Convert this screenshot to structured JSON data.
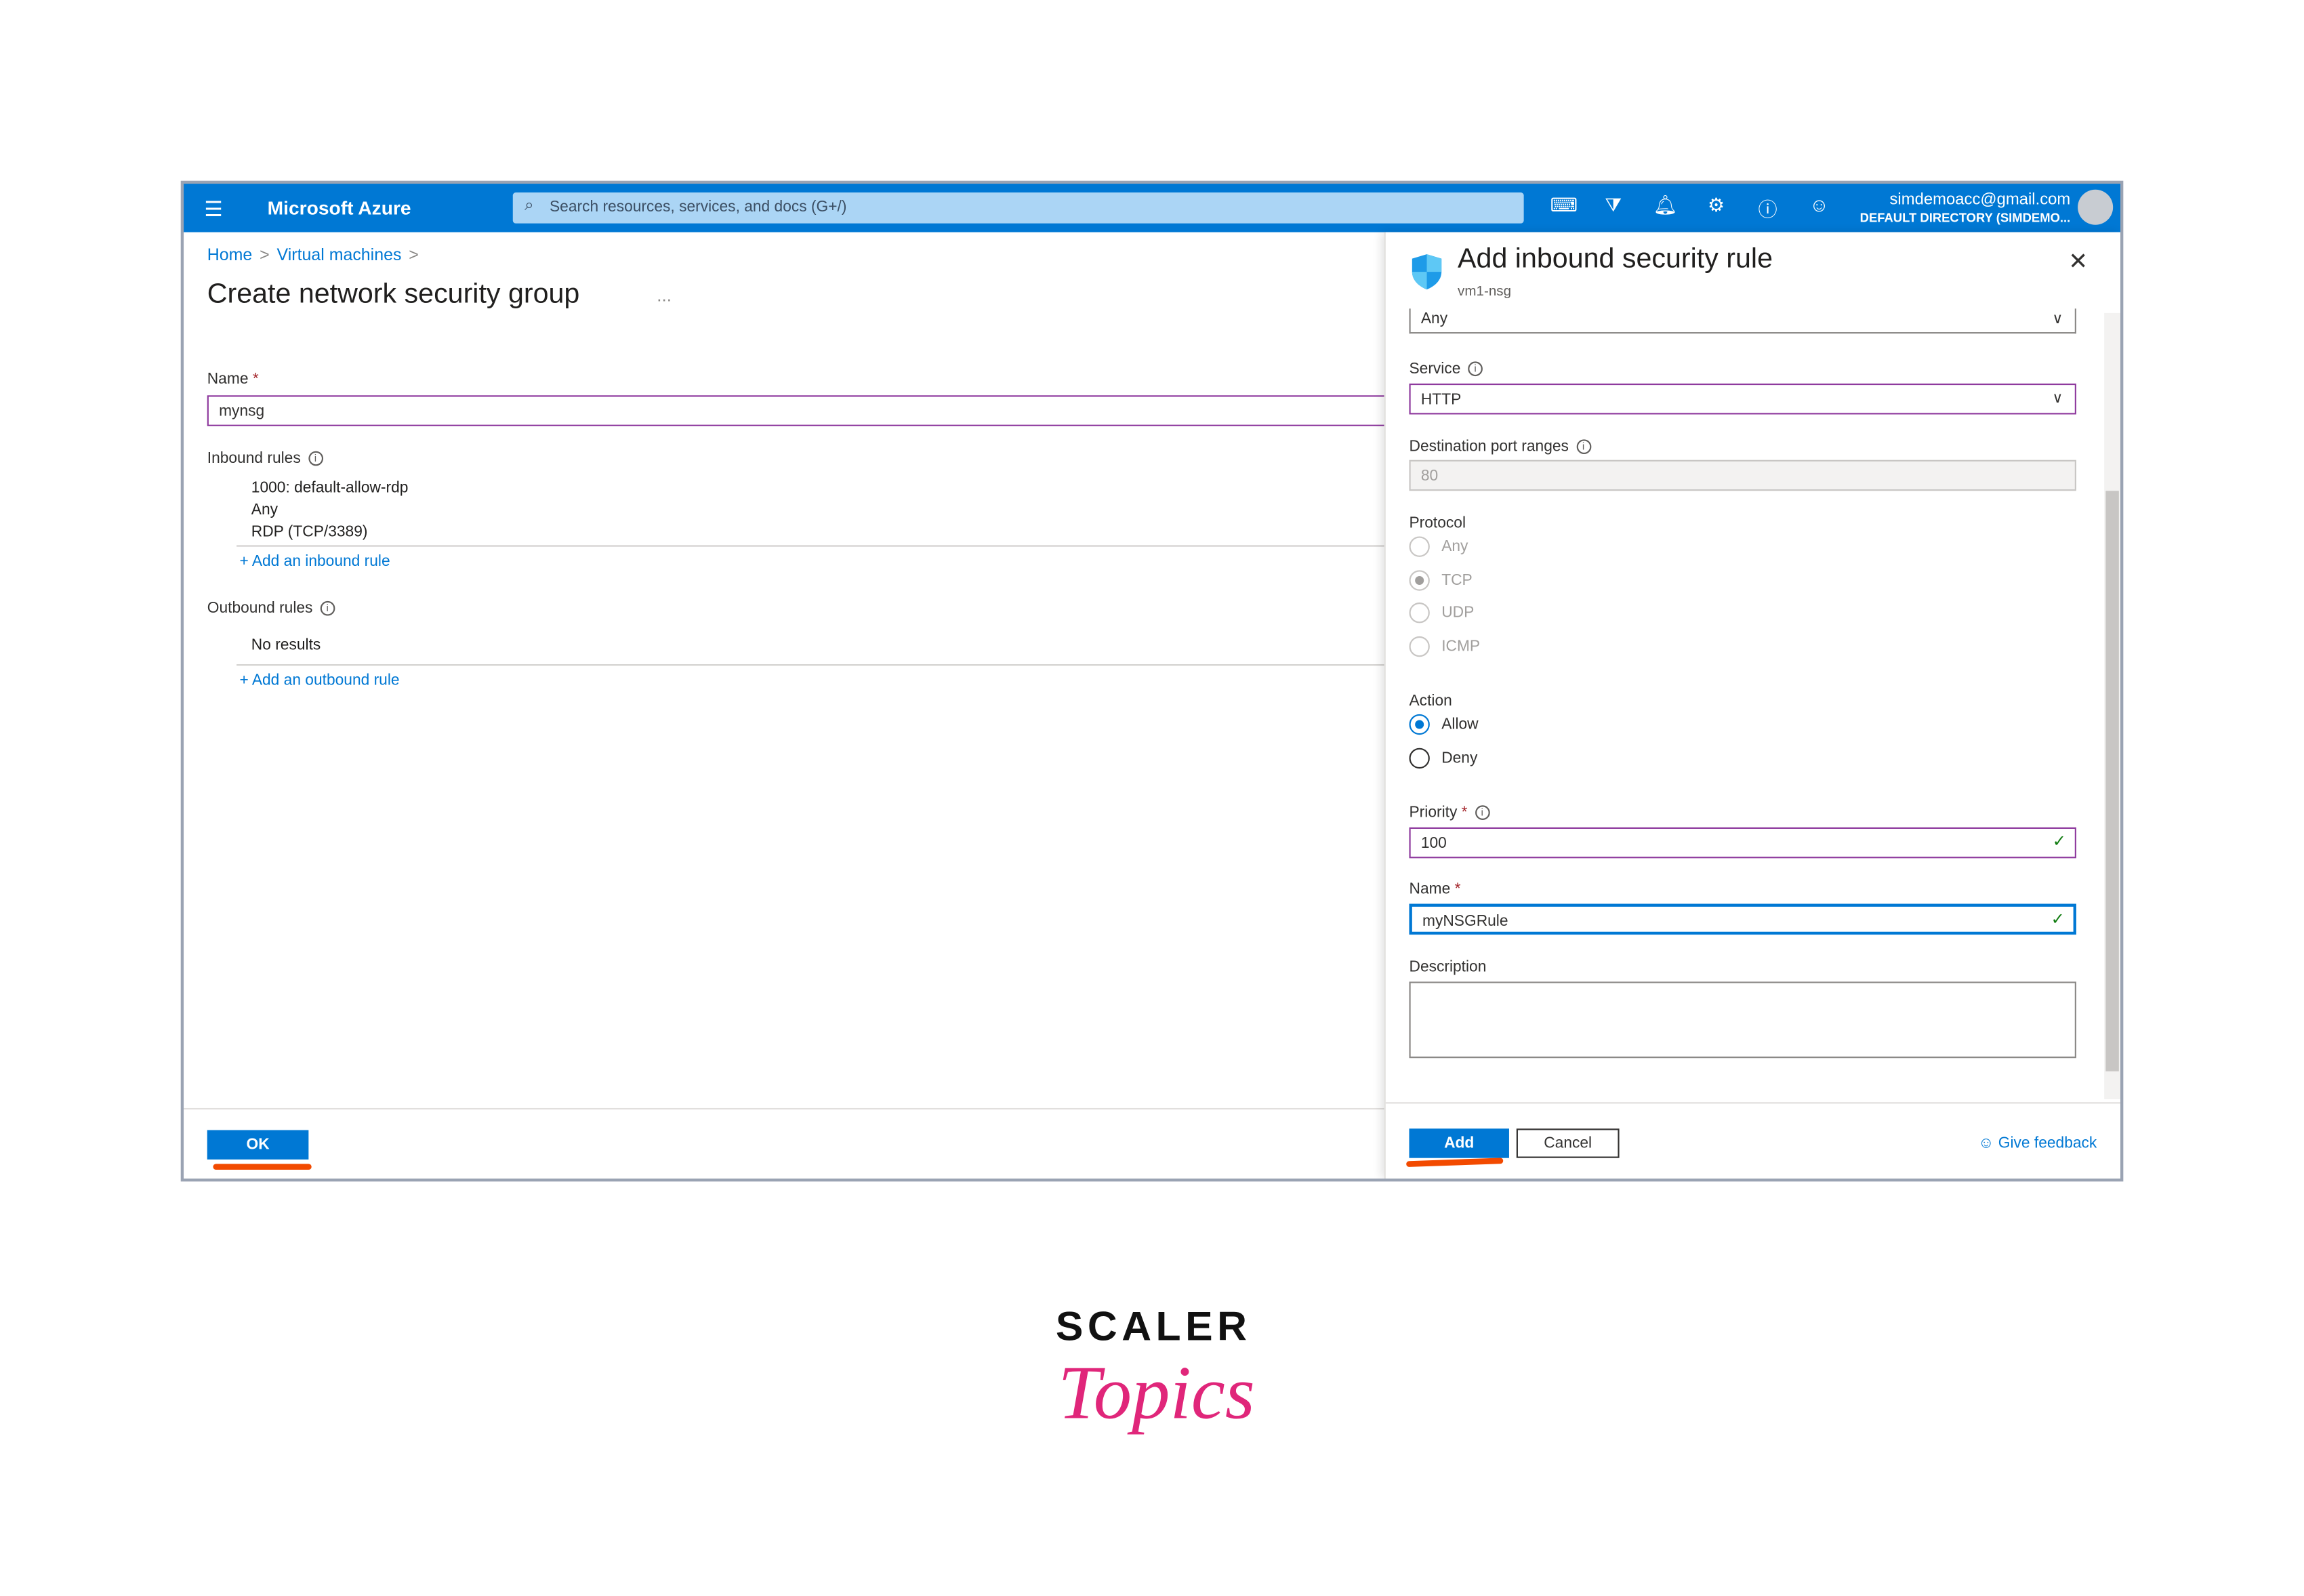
{
  "topbar": {
    "brand": "Microsoft Azure",
    "search_placeholder": "Search resources, services, and docs (G+/)",
    "account_email": "simdemoacc@gmail.com",
    "account_directory": "DEFAULT DIRECTORY (SIMDEMO...",
    "accent": "#0078d4"
  },
  "left": {
    "breadcrumb": [
      "Home",
      "Virtual machines"
    ],
    "title": "Create network security group",
    "more": "...",
    "name_label": "Name",
    "name_value": "mynsg",
    "inbound_label": "Inbound rules",
    "inbound_rule": [
      "1000: default-allow-rdp",
      "Any",
      "RDP (TCP/3389)"
    ],
    "add_inbound": "+ Add an inbound rule",
    "outbound_label": "Outbound rules",
    "outbound_empty": "No results",
    "add_outbound": "+ Add an outbound rule",
    "ok": "OK"
  },
  "panel": {
    "title": "Add inbound security rule",
    "subtitle": "vm1-nsg",
    "top_select": "Any",
    "service_label": "Service",
    "service_value": "HTTP",
    "port_label": "Destination port ranges",
    "port_value": "80",
    "protocol_label": "Protocol",
    "protocols": [
      "Any",
      "TCP",
      "UDP",
      "ICMP"
    ],
    "protocol_selected": "TCP",
    "action_label": "Action",
    "actions": [
      "Allow",
      "Deny"
    ],
    "action_selected": "Allow",
    "priority_label": "Priority",
    "priority_value": "100",
    "name_label": "Name",
    "name_value": "myNSGRule",
    "description_label": "Description",
    "add": "Add",
    "cancel": "Cancel",
    "feedback": "Give feedback"
  },
  "logo": {
    "line1": "SCALER",
    "line2": "Topics"
  }
}
